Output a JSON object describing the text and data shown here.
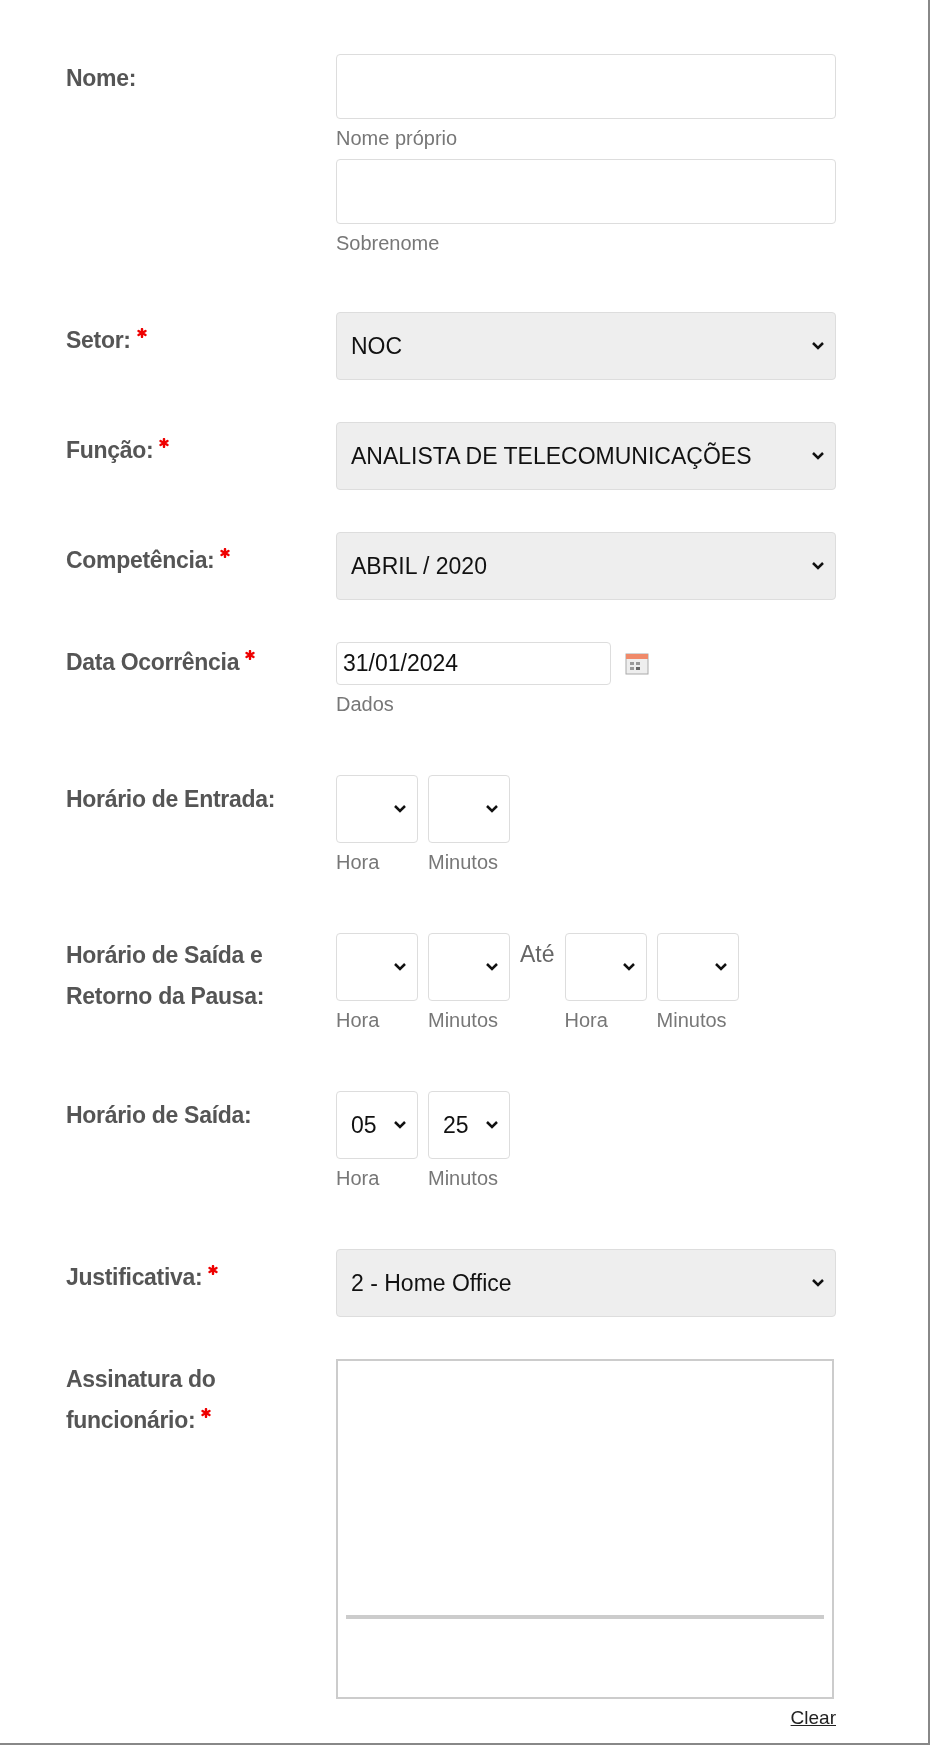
{
  "fields": [
    {
      "kind": "text_pair",
      "label": "Nome:",
      "required": false,
      "inputs": [
        {
          "sublabel": "Nome próprio"
        },
        {
          "sublabel": "Sobrenome"
        }
      ]
    },
    {
      "kind": "select",
      "label": "Setor:",
      "required": true,
      "value": "NOC"
    },
    {
      "kind": "select",
      "label": "Função:",
      "required": true,
      "value": "ANALISTA  DE TELECOMUNICAÇÕES"
    },
    {
      "kind": "select",
      "label": "Competência:",
      "required": true,
      "value": "ABRIL / 2020"
    },
    {
      "kind": "date",
      "label": "Data Ocorrência",
      "required": true,
      "value": "31/01/2024",
      "sublabel": "Dados"
    },
    {
      "kind": "time",
      "label": "Horário de  Entrada:",
      "required": false,
      "selects": [
        {
          "sublabel": "Hora"
        },
        {
          "sublabel": "Minutos"
        }
      ]
    },
    {
      "kind": "time_range",
      "label": "Horário de Saída e Retorno da  Pausa:",
      "required": false,
      "start": [
        {
          "sublabel": "Hora"
        },
        {
          "sublabel": "Minutos"
        }
      ],
      "separator": "Até",
      "end": [
        {
          "sublabel": "Hora"
        },
        {
          "sublabel": "Minutos"
        }
      ]
    },
    {
      "kind": "time",
      "label": "Horário de Saída:",
      "required": false,
      "selects": [
        {
          "value": "05",
          "sublabel": "Hora"
        },
        {
          "value": "25",
          "sublabel": "Minutos"
        }
      ]
    },
    {
      "kind": "select",
      "label": "Justificativa:",
      "required": true,
      "value": "2 -  Home Office"
    },
    {
      "kind": "signature",
      "label": "Assinatura do funcionário:",
      "required": true,
      "clear": "Clear"
    }
  ]
}
